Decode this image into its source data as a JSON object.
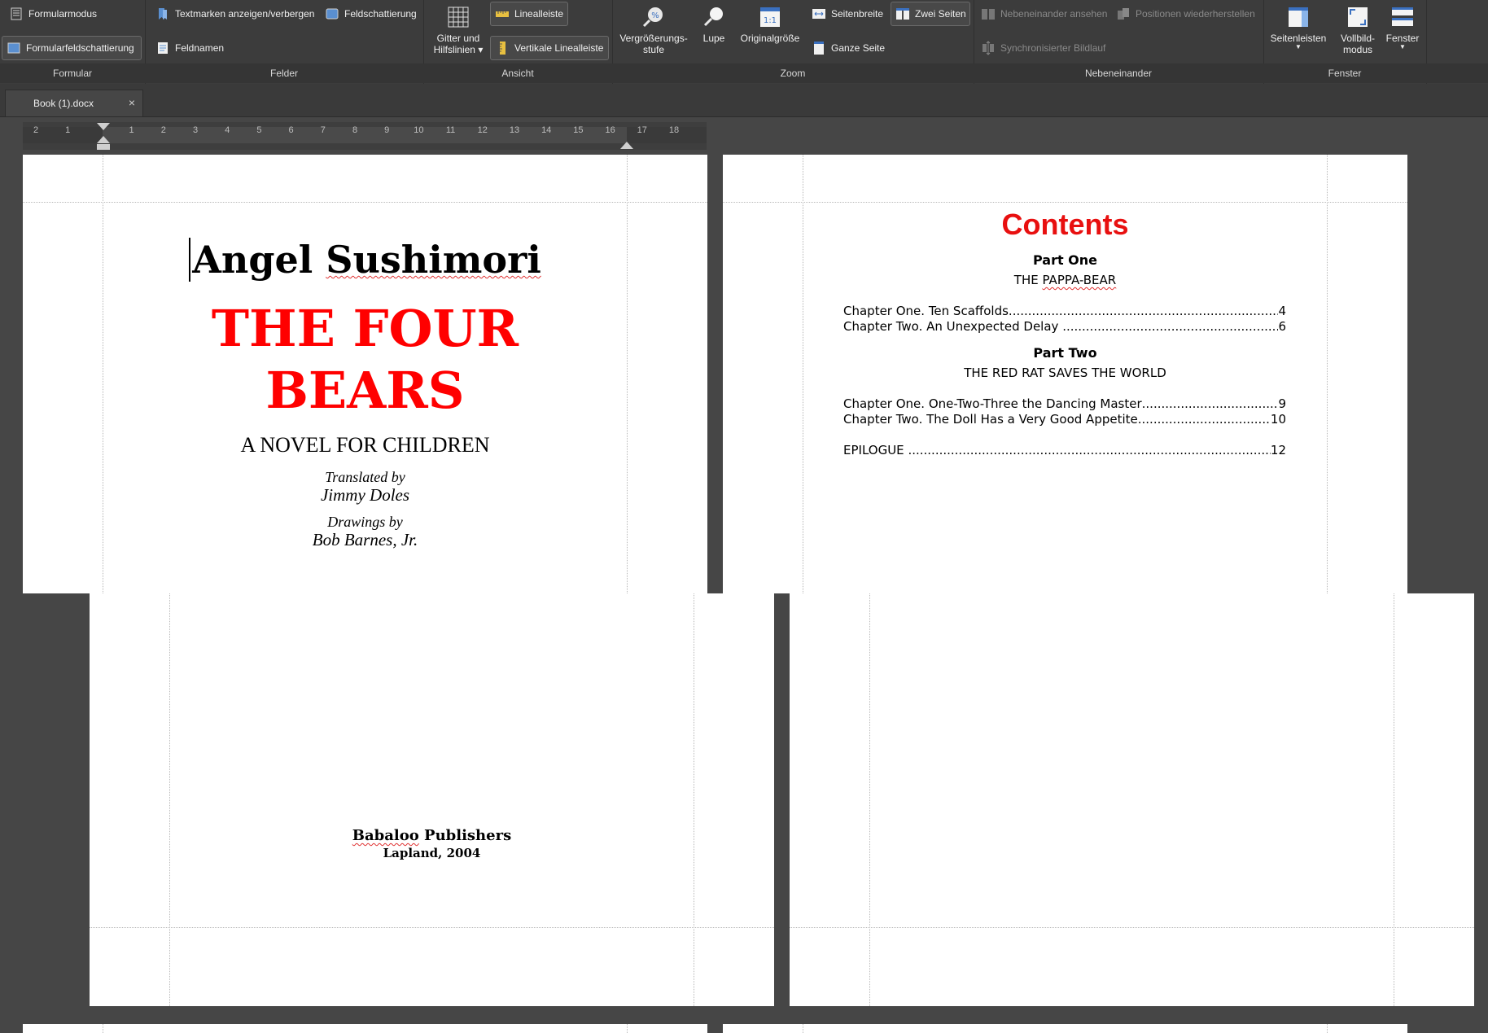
{
  "ribbon": {
    "groups": {
      "formular": "Formular",
      "felder": "Felder",
      "ansicht": "Ansicht",
      "zoom": "Zoom",
      "nebeneinander": "Nebeneinander",
      "fenster": "Fenster"
    },
    "formular": {
      "form_mode": "Formularmodus",
      "field_shading": "Formularfeldschattierung"
    },
    "felder": {
      "bookmarks": "Textmarken anzeigen/verbergen",
      "field_shading": "Feldschattierung",
      "field_names": "Feldnamen"
    },
    "ansicht": {
      "grid_line1": "Gitter und",
      "grid_line2": "Hilfslinien",
      "ruler": "Linealleiste",
      "vertical_ruler": "Vertikale Linealleiste"
    },
    "zoom": {
      "zoom_level_line1": "Vergrößerungs-",
      "zoom_level_line2": "stufe",
      "magnifier": "Lupe",
      "original_size": "Originalgröße",
      "original_glyph": "1:1",
      "page_width": "Seitenbreite",
      "two_pages": "Zwei Seiten",
      "whole_page": "Ganze Seite"
    },
    "nebeneinander": {
      "side_by_side": "Nebeneinander ansehen",
      "restore_positions": "Positionen wiederherstellen",
      "sync_scroll": "Synchronisierter Bildlauf"
    },
    "fenster": {
      "sidebars": "Seitenleisten",
      "fullscreen_line1": "Vollbild-",
      "fullscreen_line2": "modus",
      "window": "Fenster"
    }
  },
  "tabs": [
    {
      "label": "Book (1).docx",
      "close": "×"
    }
  ],
  "ruler": {
    "ticks": [
      "2",
      "1",
      "",
      "1",
      "2",
      "3",
      "4",
      "5",
      "6",
      "7",
      "8",
      "9",
      "10",
      "11",
      "12",
      "13",
      "14",
      "15",
      "16",
      "17",
      "18"
    ]
  },
  "pages": {
    "title_page": {
      "author_first": "Angel",
      "author_last": "Sushimori",
      "title_line1": "THE FOUR",
      "title_line2": "BEARS",
      "subtitle": "A NOVEL FOR CHILDREN",
      "translated_by": "Translated by",
      "translator": "Jimmy Doles",
      "drawings_by": "Drawings by",
      "illustrator": "Bob Barnes, Jr."
    },
    "contents_page": {
      "heading": "Contents",
      "part_one": "Part One",
      "part_one_title_a": "THE ",
      "part_one_title_b": "PAPPA-BEAR",
      "part_one_entries": [
        {
          "label": "Chapter One. Ten Scaffolds",
          "page": "4"
        },
        {
          "label": "Chapter Two. An Unexpected Delay ",
          "page": "6"
        }
      ],
      "part_two": "Part Two",
      "part_two_title": "THE RED RAT SAVES THE WORLD",
      "part_two_entries": [
        {
          "label": "Chapter One. One-Two-Three the Dancing Master",
          "page": "9"
        },
        {
          "label": "Chapter Two. The Doll Has a Very Good Appetite",
          "page": "10"
        }
      ],
      "epilogue": {
        "label": "EPILOGUE ",
        "page": "12"
      }
    },
    "publisher_page": {
      "publisher_a": "Babaloo",
      "publisher_b": " Publishers",
      "place_year": "Lapland, 2004"
    }
  },
  "colors": {
    "title_red": "#ff0000",
    "contents_red": "#e81010",
    "ribbon_bg": "#3c3c3c",
    "workspace_bg": "#464646"
  }
}
